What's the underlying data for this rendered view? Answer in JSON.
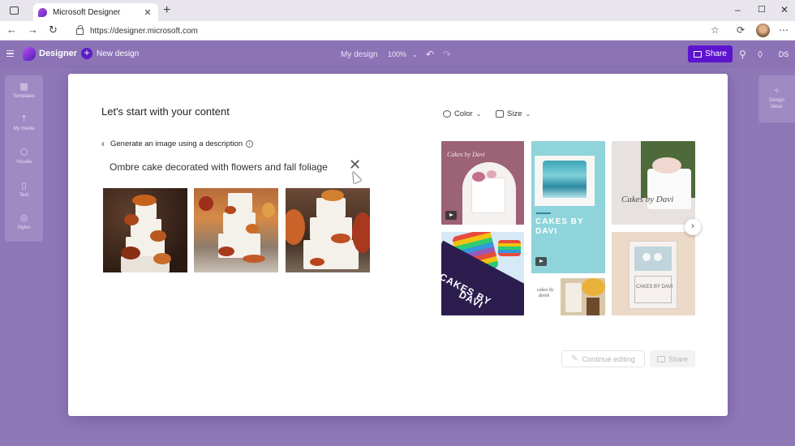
{
  "browser": {
    "tab_title": "Microsoft Designer",
    "tab_close": "✕",
    "new_tab": "+",
    "url": "https://designer.microsoft.com",
    "window_controls": {
      "minimize": "–",
      "maximize": "☐",
      "close": "✕"
    },
    "nav": {
      "back": "←",
      "forward": "→",
      "refresh": "↻"
    },
    "icons": {
      "favorite": "☆",
      "extensions": "⟳",
      "more": "⋯"
    }
  },
  "appbar": {
    "brand": "Designer",
    "new_design": "New design",
    "new_design_icon": "+",
    "document_name": "My design",
    "zoom": "100%",
    "zoom_chevron": "⌄",
    "undo": "↶",
    "redo": "↷",
    "share": "Share",
    "initials": "DS",
    "link_icon": "⚲",
    "pin_icon": "◊"
  },
  "leftrail": [
    {
      "label": "Templates",
      "icon": "▦"
    },
    {
      "label": "My media",
      "icon": "⇡"
    },
    {
      "label": "Visuals",
      "icon": "⬡"
    },
    {
      "label": "Text",
      "icon": "▯"
    },
    {
      "label": "Styles",
      "icon": "◎"
    }
  ],
  "rightrail": {
    "label_line1": "Design",
    "label_line2": "ideas",
    "icon": "✧"
  },
  "modal": {
    "title": "Let's start with your content",
    "back_label": "Generate an image using a description",
    "back_chevron": "‹",
    "info_glyph": "i",
    "prompt": "Ombre cake decorated with flowers and fall foliage",
    "clear": "✕",
    "filters": {
      "color": "Color",
      "size": "Size",
      "chevron": "⌄"
    },
    "templates": {
      "t1": "Cakes by Davi",
      "t3": "Cakes by Davi",
      "t4_line1": "CAKES BY",
      "t4_line2": "DAVI",
      "t5_line1": "CAKES BY",
      "t5_line2": "DAVI",
      "t6_line1": "cakes by",
      "t6_line2": "derek",
      "t7": "CAKES BY DAVI"
    },
    "next": "›",
    "continue_editing": "Continue editing",
    "pencil": "✎",
    "share": "Share"
  },
  "colors": {
    "accent": "#5d14cf",
    "app_background": "#8f78b8",
    "teal": "#8ed4da",
    "mauve": "#9c6275",
    "navy": "#2c1d4f"
  }
}
